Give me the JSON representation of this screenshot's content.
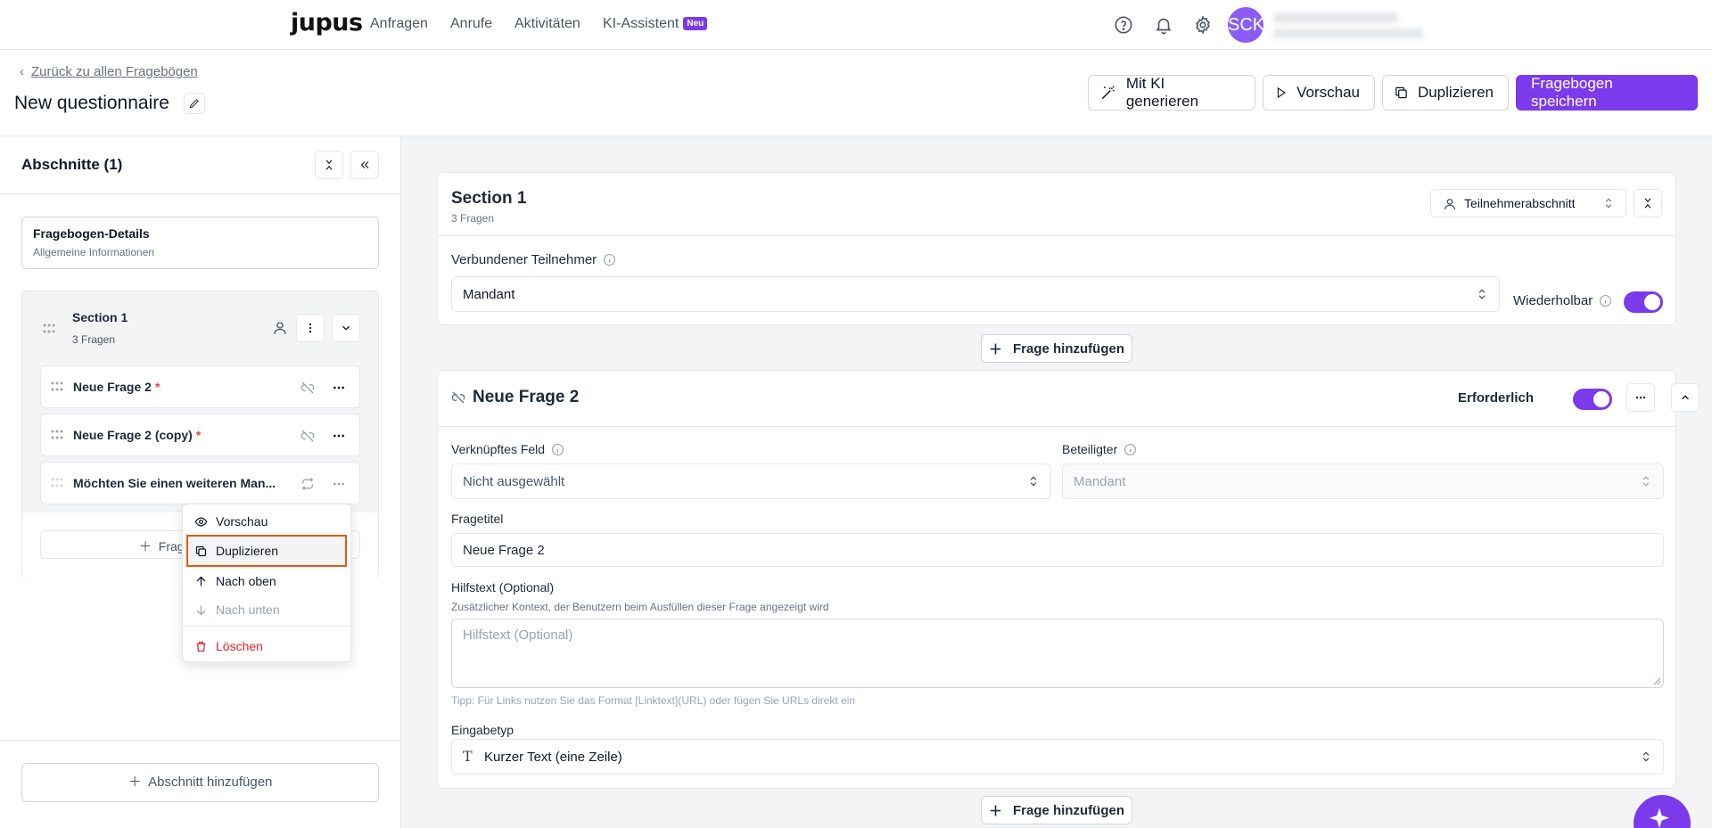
{
  "nav": {
    "logo": "jupus",
    "links": [
      "Anfragen",
      "Anrufe",
      "Aktivitäten",
      "KI-Assistent"
    ],
    "badge": "Neu",
    "avatar_initials": "SCK"
  },
  "header": {
    "back_link": "Zurück zu allen Fragebögen",
    "title": "New questionnaire",
    "buttons": {
      "generate": "Mit KI generieren",
      "preview": "Vorschau",
      "duplicate": "Duplizieren",
      "save": "Fragebogen speichern"
    }
  },
  "sidebar": {
    "title": "Abschnitte (1)",
    "details_card": {
      "title": "Fragebogen-Details",
      "subtitle": "Allgemeine Informationen"
    },
    "section": {
      "title": "Section 1",
      "subtitle": "3 Fragen",
      "questions": [
        {
          "label": "Neue Frage 2",
          "required": "*"
        },
        {
          "label": "Neue Frage 2 (copy)",
          "required": "*"
        },
        {
          "label": "Möchten Sie einen weiteren Man...",
          "required": ""
        }
      ],
      "add_question": "Frag"
    },
    "add_section": "Abschnitt hinzufügen"
  },
  "context_menu": {
    "items": [
      {
        "label": "Vorschau",
        "icon": "eye-icon",
        "state": "normal"
      },
      {
        "label": "Duplizieren",
        "icon": "copy-icon",
        "state": "highlighted"
      },
      {
        "label": "Nach oben",
        "icon": "arrow-up-icon",
        "state": "normal"
      },
      {
        "label": "Nach unten",
        "icon": "arrow-down-icon",
        "state": "disabled"
      },
      {
        "label": "Löschen",
        "icon": "trash-icon",
        "state": "danger"
      }
    ]
  },
  "main": {
    "section_card": {
      "title": "Section 1",
      "subtitle": "3 Fragen",
      "type_select": "Teilnehmerabschnitt",
      "linked_participant_label": "Verbundener Teilnehmer",
      "linked_participant_value": "Mandant",
      "repeatable_label": "Wiederholbar"
    },
    "add_question": "Frage hinzufügen",
    "question_card": {
      "title": "Neue Frage 2",
      "required_label": "Erforderlich",
      "linked_field_label": "Verknüpftes Feld",
      "linked_field_value": "Nicht ausgewählt",
      "participant_label": "Beteiligter",
      "participant_value": "Mandant",
      "question_title_label": "Fragetitel",
      "question_title_value": "Neue Frage 2",
      "help_label": "Hilfstext (Optional)",
      "help_description": "Zusätzlicher Kontext, der Benutzern beim Ausfüllen dieser Frage angezeigt wird",
      "help_placeholder": "Hilfstext (Optional)",
      "help_tip": "Tipp: Für Links nutzen Sie das Format [Linktext](URL) oder fügen Sie URLs direkt ein",
      "input_type_label": "Eingabetyp",
      "input_type_value": "Kurzer Text (eine Zeile)"
    }
  },
  "colors": {
    "accent": "#7c3aed",
    "danger": "#dc2626",
    "highlight_border": "#ea580c"
  }
}
